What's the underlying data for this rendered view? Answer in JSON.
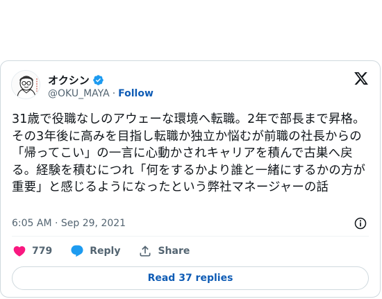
{
  "author": {
    "name": "オクシン",
    "handle": "@OKU_MAYA",
    "follow_label": "Follow",
    "separator": "·",
    "verified": true
  },
  "tweet": {
    "text": "31歳で役職なしのアウェーな環境へ転職。2年で部長まで昇格。その3年後に高みを目指し転職か独立か悩むが前職の社長からの「帰ってこい」の一言に心動かされキャリアを積んで古巣へ戻る。経験を積むにつれ「何をするかより誰と一緒にするかの方が重要」と感じるようになったという弊社マネージャーの話",
    "timestamp": "6:05 AM · Sep 29, 2021"
  },
  "actions": {
    "like_count": "779",
    "reply_label": "Reply",
    "share_label": "Share"
  },
  "replies_button": "Read 37 replies",
  "colors": {
    "text": "#0f1419",
    "muted": "#536471",
    "link": "#0f5cb5",
    "heart": "#f91880",
    "reply": "#1d9bf0",
    "border": "#cfd9de"
  },
  "icons": {
    "verified": "verified-badge-icon",
    "brand": "x-logo-icon",
    "info": "info-icon",
    "like": "heart-icon",
    "reply": "speech-bubble-icon",
    "share": "share-icon"
  }
}
